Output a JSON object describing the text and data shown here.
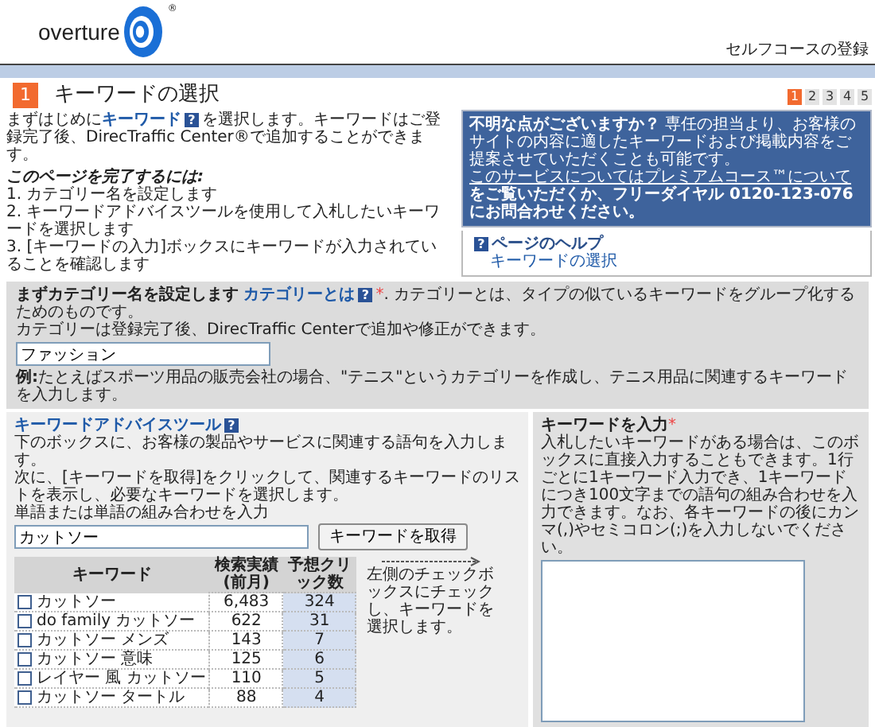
{
  "header": {
    "logo": {
      "wordmark": "overture",
      "registered": "®"
    },
    "page_title": "セルフコースの登録"
  },
  "step": {
    "number": "1",
    "title": "キーワードの選択"
  },
  "pager": [
    {
      "label": "1",
      "selected": true
    },
    {
      "label": "2",
      "selected": false
    },
    {
      "label": "3",
      "selected": false
    },
    {
      "label": "4",
      "selected": false
    },
    {
      "label": "5",
      "selected": false
    }
  ],
  "intro": {
    "before": "まずはじめに",
    "link": "キーワード",
    "help_mark": "?",
    "after": "を選択します。キーワードはご登録完了後、DirecTraffic Center®で追加することができます。"
  },
  "steps_heading": "このページを完了するには:",
  "steps": [
    "1. カテゴリー名を設定します",
    "2. キーワードアドバイスツールを使用して入札したいキーワードを選択します",
    "3. [キーワードの入力]ボックスにキーワードが入力されていることを確認します"
  ],
  "notice": {
    "before": "**不明な点がございますか？** 専任の担当より、お客様のサイトの内容に適したキーワードおよび掲載内容をご提案させていただくことも可能です。",
    "link": "このサービスについてはプレミアムコース™について",
    "after": "をご覧いただくか、フリーダイヤル 0120-123-076 にお問合わせください。"
  },
  "page_help": {
    "mark": "?",
    "title": "ページのヘルプ",
    "link": "キーワードの選択"
  },
  "category": {
    "heading": "まずカテゴリー名を設定します",
    "link": "カテゴリーとは",
    "help_mark": "?",
    "required": "*",
    "description": ". カテゴリーとは、タイプの似ているキーワードをグループ化するためのものです。",
    "note": "カテゴリーは登録完了後、DirecTraffic Centerで追加や修正ができます。",
    "value": "ファッション",
    "example": "**例:**たとえばスポーツ用品の販売会社の場合、\"テニス\"というカテゴリーを作成し、テニス用品に関連するキーワードを入力します。"
  },
  "advice_tool": {
    "title": "キーワードアドバイスツール",
    "help_mark": "?",
    "description": [
      "下のボックスに、お客様の製品やサービスに関連する語句を入力します。",
      "次に、[キーワードを取得]をクリックして、関連するキーワードのリストを表示し、必要なキーワードを選択します。"
    ],
    "input_label": "単語または単語の組み合わせを入力",
    "input_value": "カットソー",
    "button": "キーワードを取得",
    "columns": [
      "キーワード",
      "検索実績(前月)",
      "予想クリック数"
    ],
    "rows": [
      {
        "keyword": "カットソー",
        "searches": "6,483",
        "clicks": "324",
        "checked": false
      },
      {
        "keyword": "do family カットソー",
        "searches": "622",
        "clicks": "31",
        "checked": false
      },
      {
        "keyword": "カットソー メンズ",
        "searches": "143",
        "clicks": "7",
        "checked": false
      },
      {
        "keyword": "カットソー 意味",
        "searches": "125",
        "clicks": "6",
        "checked": false
      },
      {
        "keyword": "レイヤー 風 カットソー",
        "searches": "110",
        "clicks": "5",
        "checked": false
      },
      {
        "keyword": "カットソー タートル",
        "searches": "88",
        "clicks": "4",
        "checked": false
      }
    ],
    "hint": "左側のチェックボックスにチェックし、キーワードを選択します。"
  },
  "keyword_entry": {
    "title": "キーワードを入力",
    "required": "*",
    "description": "入札したいキーワードがある場合は、このボックスに直接入力することもできます。1行ごとに1キーワード入力でき、1キーワードにつき100文字までの語句の組み合わせを入力できます。なお、各キーワードの後にカンマ(,)やセミコロン(;)を入力しないでください。"
  }
}
